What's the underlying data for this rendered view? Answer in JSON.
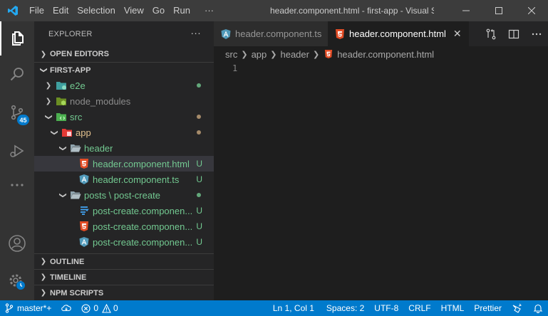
{
  "window": {
    "title": "header.component.html - first-app - Visual St...",
    "menu": [
      "File",
      "Edit",
      "Selection",
      "View",
      "Go",
      "Run",
      "···"
    ]
  },
  "activity_bar": {
    "scm_badge": "45"
  },
  "explorer": {
    "header": "EXPLORER",
    "more": "···",
    "open_editors": "OPEN EDITORS",
    "root": "FIRST-APP",
    "tree": [
      {
        "name": "e2e",
        "status": "",
        "color": "#73c991"
      },
      {
        "name": "node_modules",
        "status": "",
        "color": "#8c8c8c"
      },
      {
        "name": "src",
        "status": "",
        "color": "#73c991"
      },
      {
        "name": "app",
        "status": "",
        "color": "#e2c08d"
      },
      {
        "name": "header",
        "status": "",
        "color": "#73c991"
      },
      {
        "name": "header.component.html",
        "status": "U",
        "color": "#73c991"
      },
      {
        "name": "header.component.ts",
        "status": "U",
        "color": "#73c991"
      },
      {
        "name": "posts \\ post-create",
        "status": "",
        "color": "#73c991"
      },
      {
        "name": "post-create.componen...",
        "status": "U",
        "color": "#73c991"
      },
      {
        "name": "post-create.componen...",
        "status": "U",
        "color": "#73c991"
      },
      {
        "name": "post-create.componen...",
        "status": "U",
        "color": "#73c991"
      }
    ],
    "outline": "OUTLINE",
    "timeline": "TIMELINE",
    "npm_scripts": "NPM SCRIPTS"
  },
  "tabs": [
    {
      "label": "header.component.ts",
      "active": false
    },
    {
      "label": "header.component.html",
      "active": true
    }
  ],
  "breadcrumb": {
    "parts": [
      "src",
      "app",
      "header"
    ],
    "file": "header.component.html"
  },
  "editor": {
    "line_number": "1"
  },
  "statusbar": {
    "branch": "master*+",
    "errors": "0",
    "warnings": "0",
    "position": "Ln 1, Col 1",
    "spaces": "Spaces: 2",
    "encoding": "UTF-8",
    "eol": "CRLF",
    "language": "HTML",
    "formatter": "Prettier"
  },
  "colors": {
    "accent": "#007acc",
    "untracked": "#73c991",
    "modified": "#e2c08d",
    "html_icon": "#e44d26",
    "ts_icon": "#519aba",
    "css_icon": "#42a5f5"
  }
}
